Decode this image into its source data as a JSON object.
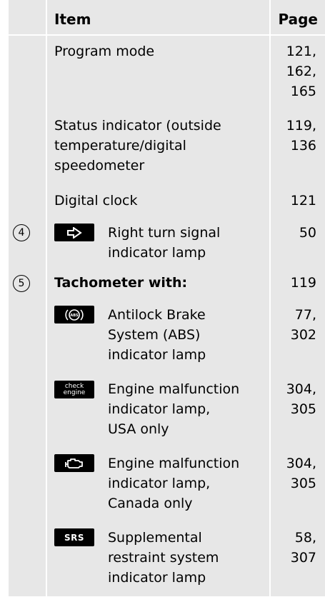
{
  "header": {
    "item": "Item",
    "page": "Page"
  },
  "rows": [
    {
      "item": "Program mode",
      "page": "121,\n162,\n165"
    },
    {
      "item": "Status indicator (outside\ntemperature/digital\nspeedometer",
      "page": "119,\n136"
    },
    {
      "item": "Digital clock",
      "page": "121"
    },
    {
      "number": "4",
      "icon": "right-turn-signal-arrow-icon",
      "item": "Right turn signal\nindicator lamp",
      "page": "50"
    },
    {
      "number": "5",
      "item": "Tachometer with:",
      "page": "119"
    },
    {
      "icon": "abs-icon",
      "item": "Antilock Brake\nSystem (ABS)\nindicator lamp",
      "page": "77,\n302"
    },
    {
      "icon": "check-engine-icon",
      "icon_text": "check\nengine",
      "item": "Engine malfunction\nindicator lamp,\nUSA only",
      "page": "304,\n305"
    },
    {
      "icon": "engine-icon",
      "item": "Engine malfunction\nindicator lamp,\nCanada only",
      "page": "304,\n305"
    },
    {
      "icon": "srs-icon",
      "icon_text": "SRS",
      "item": "Supplemental\nrestraint system\nindicator lamp",
      "page": "58,\n307"
    }
  ]
}
